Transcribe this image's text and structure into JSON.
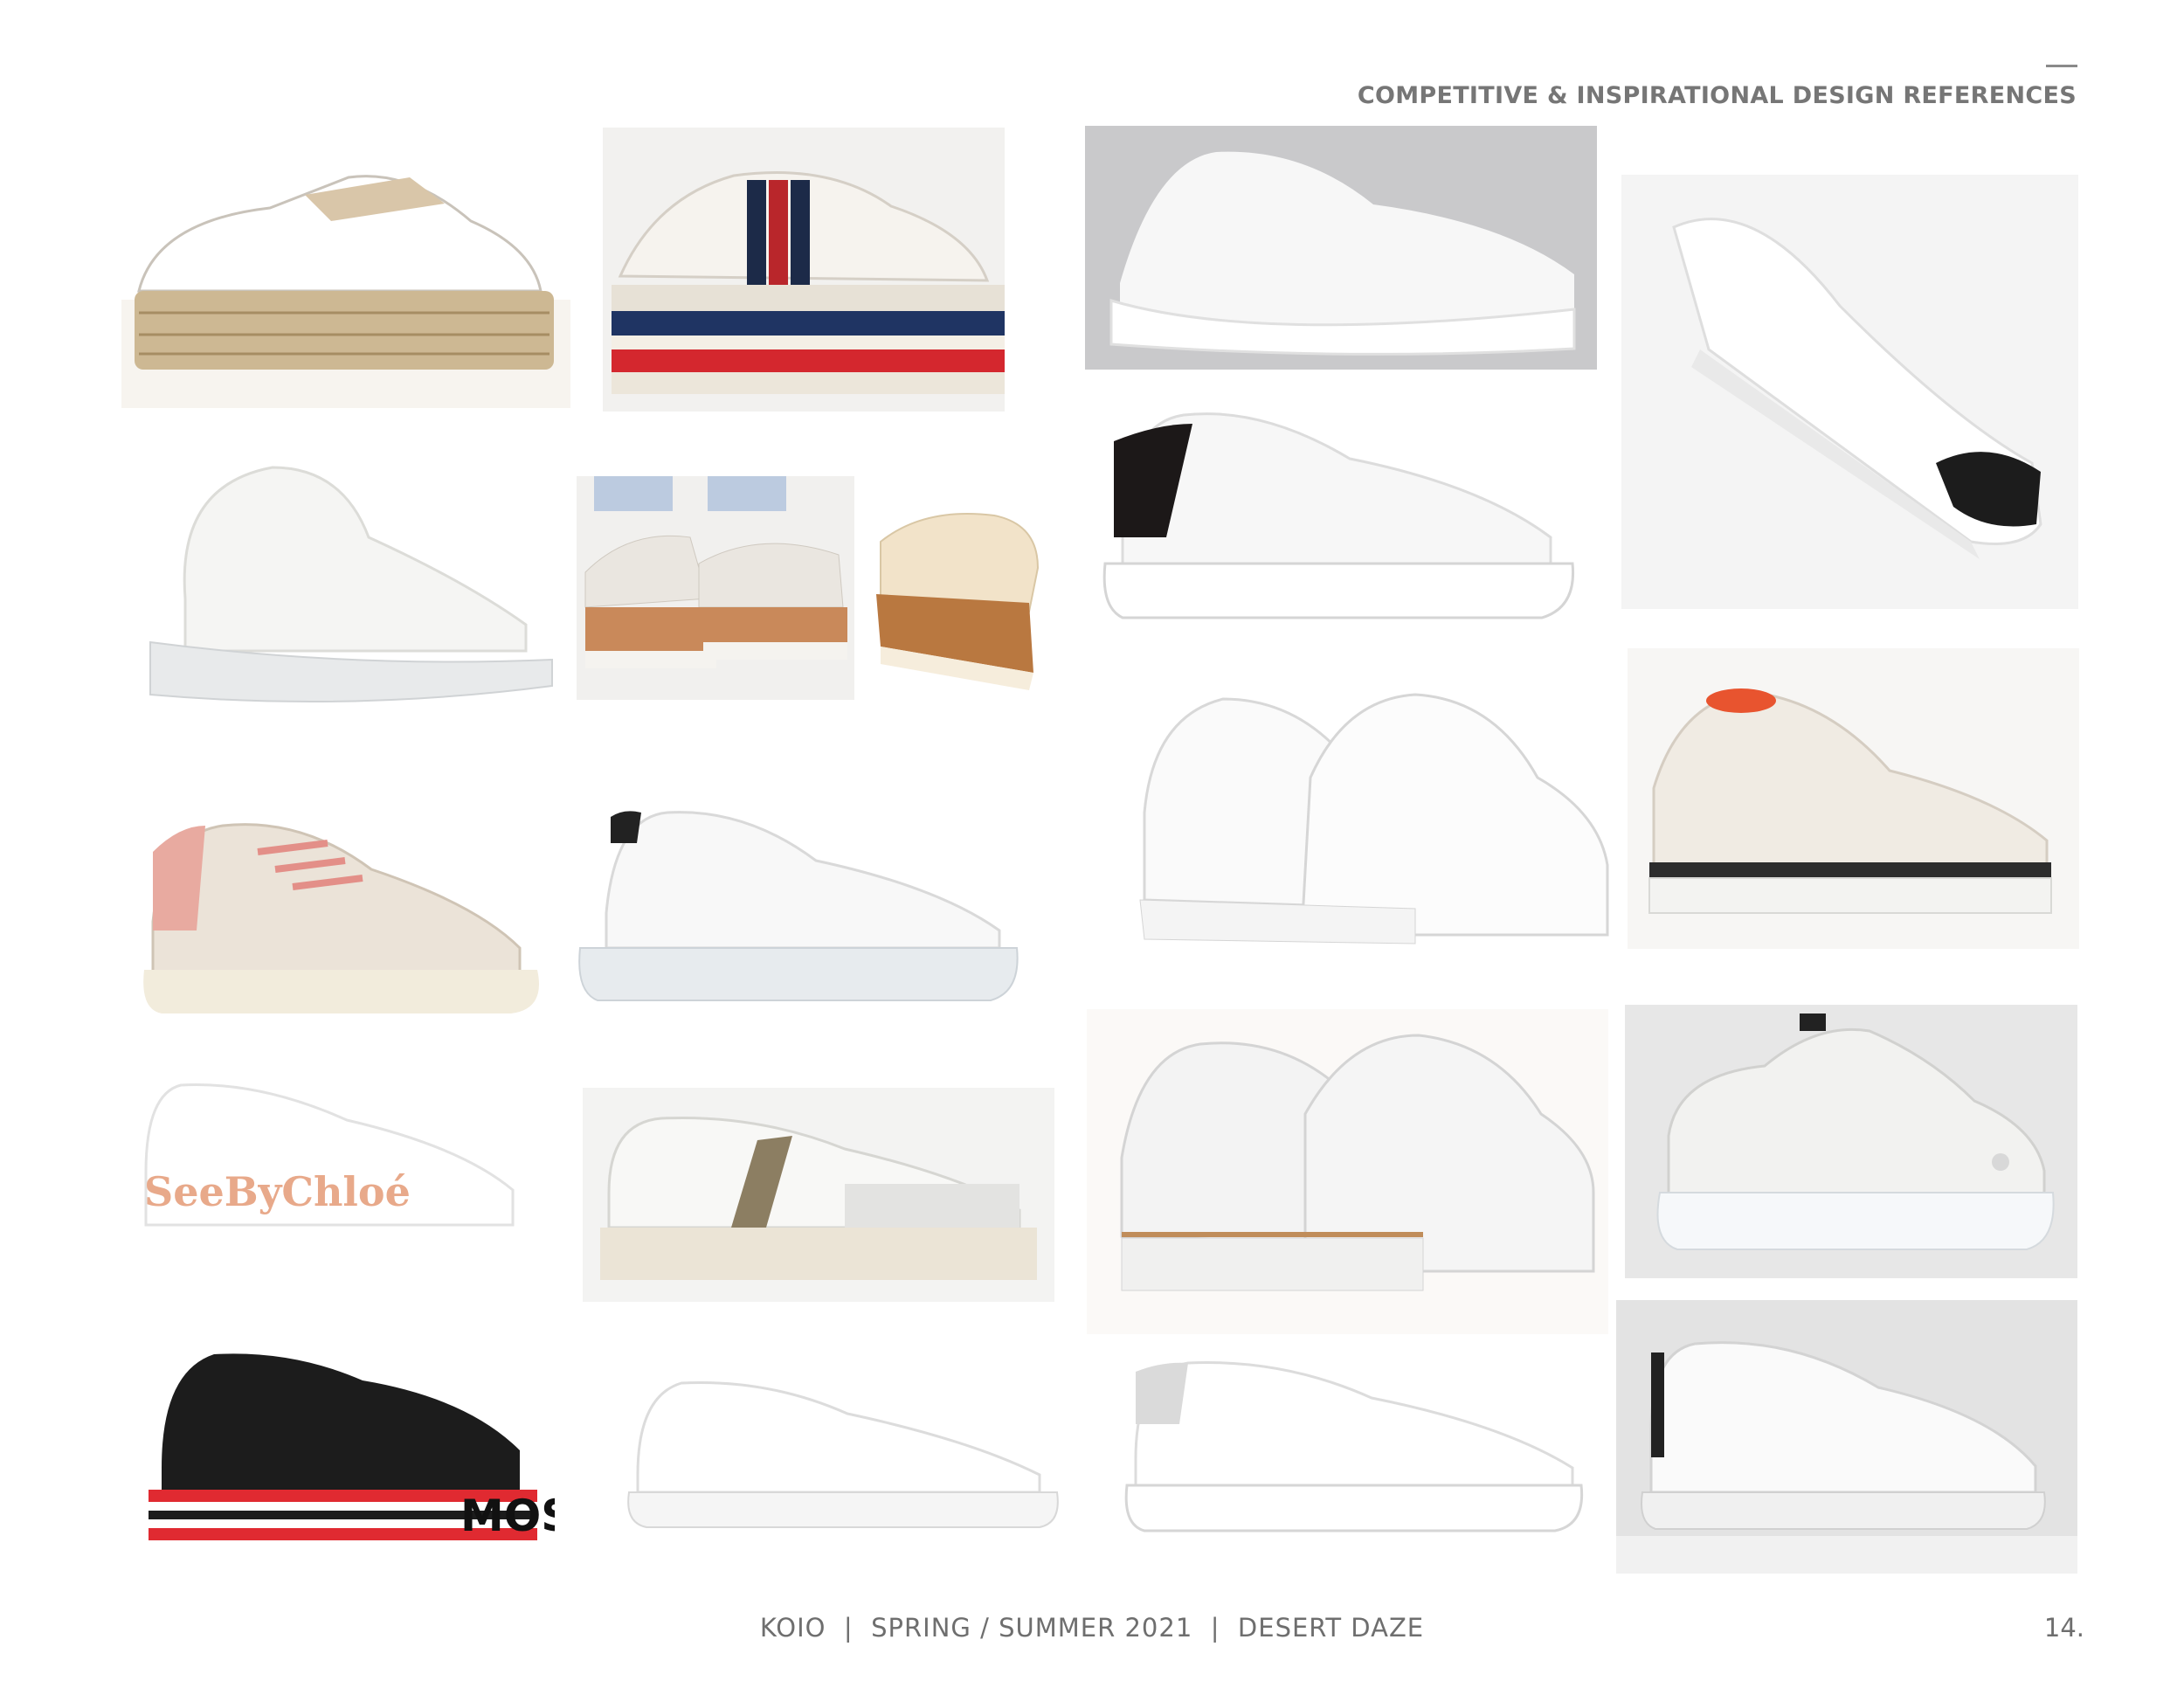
{
  "header": {
    "title": "COMPETITIVE & INSPIRATIONAL DESIGN REFERENCES"
  },
  "footer": {
    "text": "KOIO  |  SPRING / SUMMER 2021  |  DESERT DAZE",
    "page": "14."
  },
  "images": {
    "see_by_chloe_wordmark": "SeeByChloé",
    "moschino_wordmark": "MOS"
  }
}
